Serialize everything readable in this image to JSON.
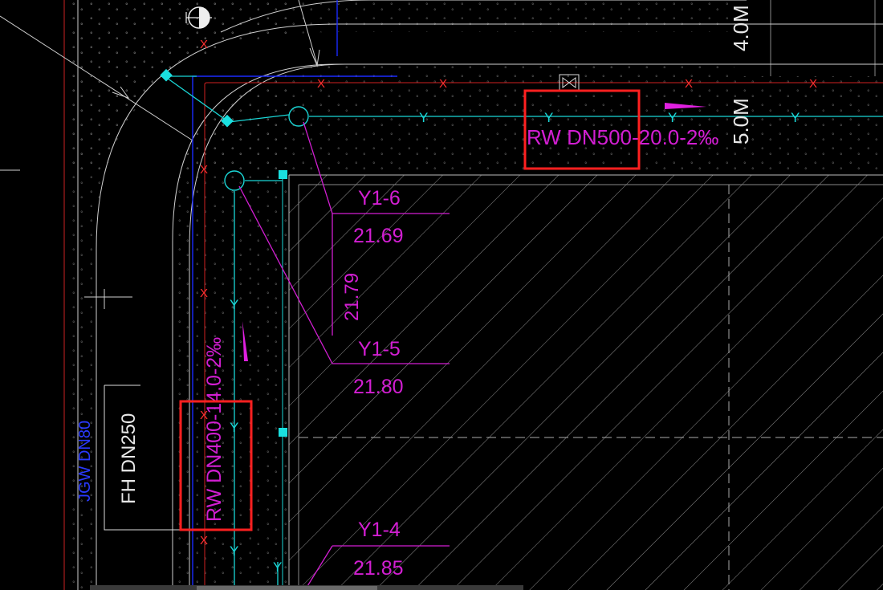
{
  "colors": {
    "background": "#000000",
    "pipe_rw": "#1ad6d6",
    "annotation": "#d21ed2",
    "water_mark": "#ff2a2a",
    "highlight_box": "#ff2020",
    "property_line": "#1a2aff",
    "road": "#cfcfcf",
    "hatch": "#9a9a9a"
  },
  "labels": {
    "rw_main": "RW DN500-20.0-2‰",
    "rw_branch": "RW DN400-14.0-2‰",
    "fh": "FH DN250",
    "jgw": "JGW DN80",
    "dim_5m": "5.0M",
    "dim_4m": "4.0M"
  },
  "manholes": {
    "y1_6": {
      "id": "Y1-6",
      "elev": "21.69"
    },
    "y1_5": {
      "id": "Y1-5",
      "elev": "21.80"
    },
    "y1_4": {
      "id": "Y1-4",
      "elev": "21.85"
    },
    "vertical_elev": "21.79"
  },
  "glyphs": {
    "y_mark": "Y",
    "x_mark": "X"
  }
}
